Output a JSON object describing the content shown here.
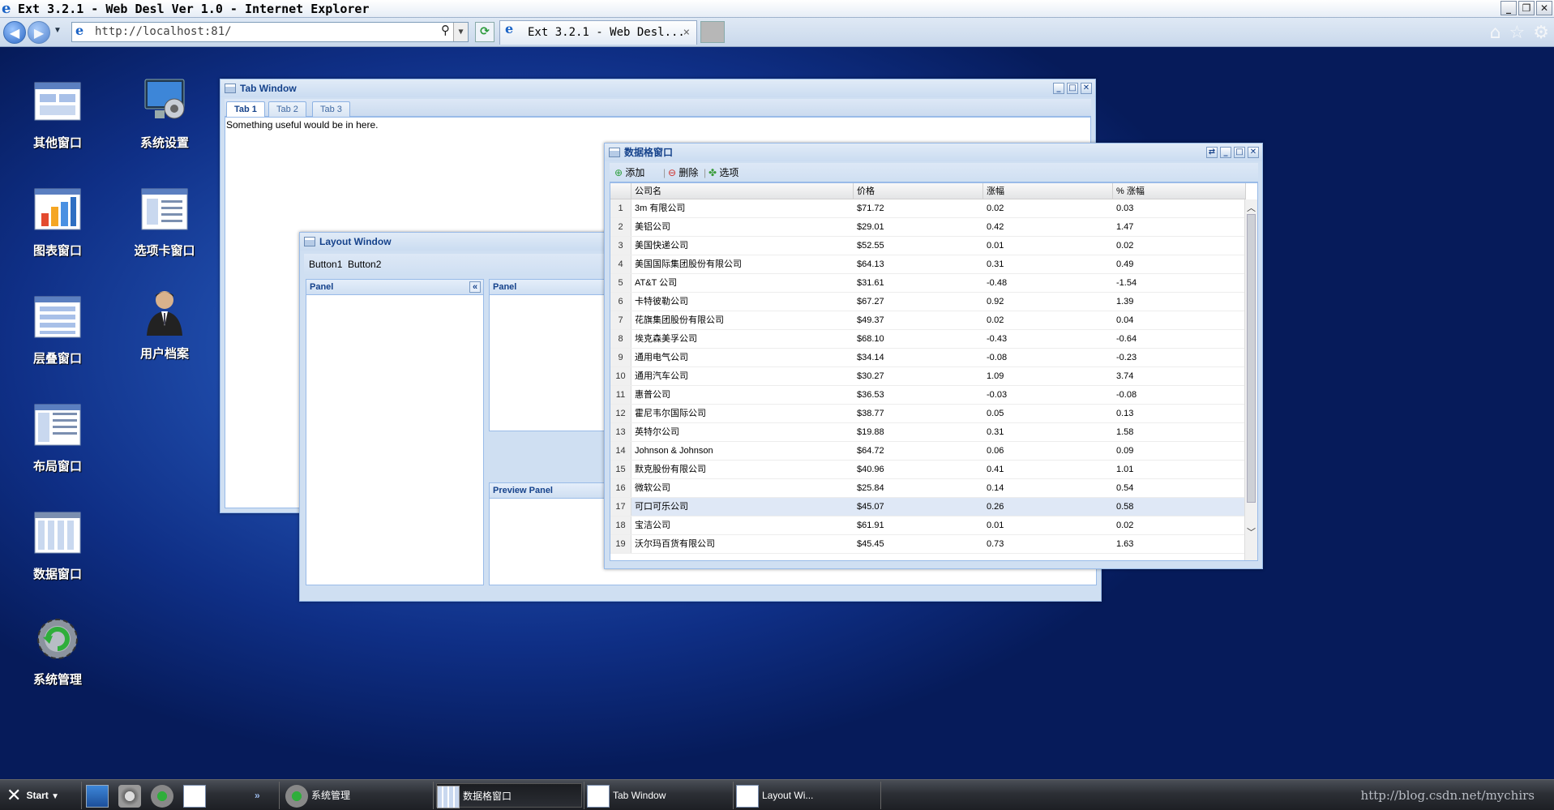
{
  "browser": {
    "title": "Ext 3.2.1 - Web Desl Ver 1.0 - Internet Explorer",
    "url": "http://localhost:81/",
    "tab_title": "Ext 3.2.1 - Web Desl...",
    "tab_close": "×",
    "min": "_",
    "restore": "❐",
    "close": "✕"
  },
  "icons": {
    "back": "back-arrow-icon",
    "forward": "forward-arrow-icon",
    "home": "home-icon",
    "star": "star-icon",
    "gear": "gear-icon"
  },
  "desktop": [
    {
      "label": "其他窗口"
    },
    {
      "label": "系统设置"
    },
    {
      "label": "图表窗口"
    },
    {
      "label": "选项卡窗口"
    },
    {
      "label": "层叠窗口"
    },
    {
      "label": "用户档案"
    },
    {
      "label": "布局窗口"
    },
    {
      "label": "数据窗口"
    },
    {
      "label": "系统管理"
    }
  ],
  "tab_window": {
    "title": "Tab Window",
    "tabs": [
      "Tab 1",
      "Tab 2",
      "Tab 3"
    ],
    "content": "Something useful would be in here."
  },
  "layout_window": {
    "title": "Layout Window",
    "button1": "Button1",
    "button2": "Button2",
    "panel_left": "Panel",
    "panel_center": "Panel",
    "preview": "Preview Panel",
    "collapse": "«"
  },
  "grid_window": {
    "title": "数据格窗口",
    "toolbar": {
      "add": "添加",
      "delete": "删除",
      "options": "选项"
    },
    "columns": [
      "公司名",
      "价格",
      "涨幅",
      "% 涨幅"
    ],
    "rows": [
      [
        "1",
        "3m 有限公司",
        "$71.72",
        "0.02",
        "0.03"
      ],
      [
        "2",
        "美铝公司",
        "$29.01",
        "0.42",
        "1.47"
      ],
      [
        "3",
        "美国快递公司",
        "$52.55",
        "0.01",
        "0.02"
      ],
      [
        "4",
        "美国国际集团股份有限公司",
        "$64.13",
        "0.31",
        "0.49"
      ],
      [
        "5",
        "AT&T 公司",
        "$31.61",
        "-0.48",
        "-1.54"
      ],
      [
        "6",
        "卡特彼勒公司",
        "$67.27",
        "0.92",
        "1.39"
      ],
      [
        "7",
        "花旗集团股份有限公司",
        "$49.37",
        "0.02",
        "0.04"
      ],
      [
        "8",
        "埃克森美孚公司",
        "$68.10",
        "-0.43",
        "-0.64"
      ],
      [
        "9",
        "通用电气公司",
        "$34.14",
        "-0.08",
        "-0.23"
      ],
      [
        "10",
        "通用汽车公司",
        "$30.27",
        "1.09",
        "3.74"
      ],
      [
        "11",
        "惠普公司",
        "$36.53",
        "-0.03",
        "-0.08"
      ],
      [
        "12",
        "霍尼韦尔国际公司",
        "$38.77",
        "0.05",
        "0.13"
      ],
      [
        "13",
        "英特尔公司",
        "$19.88",
        "0.31",
        "1.58"
      ],
      [
        "14",
        "Johnson & Johnson",
        "$64.72",
        "0.06",
        "0.09"
      ],
      [
        "15",
        "默克股份有限公司",
        "$40.96",
        "0.41",
        "1.01"
      ],
      [
        "16",
        "微软公司",
        "$25.84",
        "0.14",
        "0.54"
      ],
      [
        "17",
        "可口可乐公司",
        "$45.07",
        "0.26",
        "0.58"
      ],
      [
        "18",
        "宝洁公司",
        "$61.91",
        "0.01",
        "0.02"
      ],
      [
        "19",
        "沃尔玛百货有限公司",
        "$45.45",
        "0.73",
        "1.63"
      ]
    ],
    "selected_row": 17
  },
  "taskbar": {
    "start": "Start",
    "items": [
      "系统管理",
      "数据格窗口",
      "Tab Window",
      "Layout Wi..."
    ],
    "more": "»"
  },
  "watermark": "http://blog.csdn.net/mychirs",
  "colors": {
    "ext_blue": "#15428b",
    "panel_bg": "#cfdff2",
    "selected_row": "#dfe8f6"
  }
}
